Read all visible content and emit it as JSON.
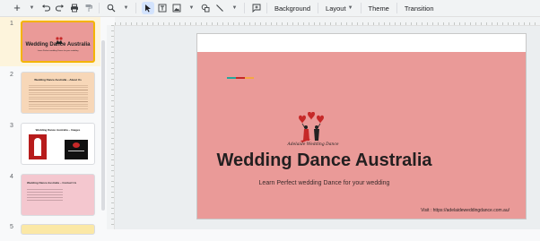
{
  "toolbar": {
    "background": "Background",
    "layout": "Layout",
    "theme": "Theme",
    "transition": "Transition"
  },
  "slides": [
    {
      "number": "1",
      "title": "Wedding Dance Australia",
      "subtitle": "Learn Perfect wedding Dance for your wedding"
    },
    {
      "number": "2",
      "title": "Wedding Dance Australia – About Us"
    },
    {
      "number": "3",
      "title": "Wedding Dance Australia – Images"
    },
    {
      "number": "4",
      "title": "Wedding Dance Australia – Contact Us"
    },
    {
      "number": "5"
    }
  ],
  "main_slide": {
    "title": "Wedding Dance Australia",
    "subtitle": "Learn Perfect wedding Dance for your wedding",
    "visit": "Visit : https://adelaideweddingdance.com.au/",
    "logo_text": "Adelaide Wedding Dance",
    "background_color": "#ea9a98"
  },
  "colors": {
    "accent_red": "#c62828",
    "accent_teal": "#26a69a",
    "accent_orange": "#f4a742",
    "selected_border": "#f4b400"
  }
}
